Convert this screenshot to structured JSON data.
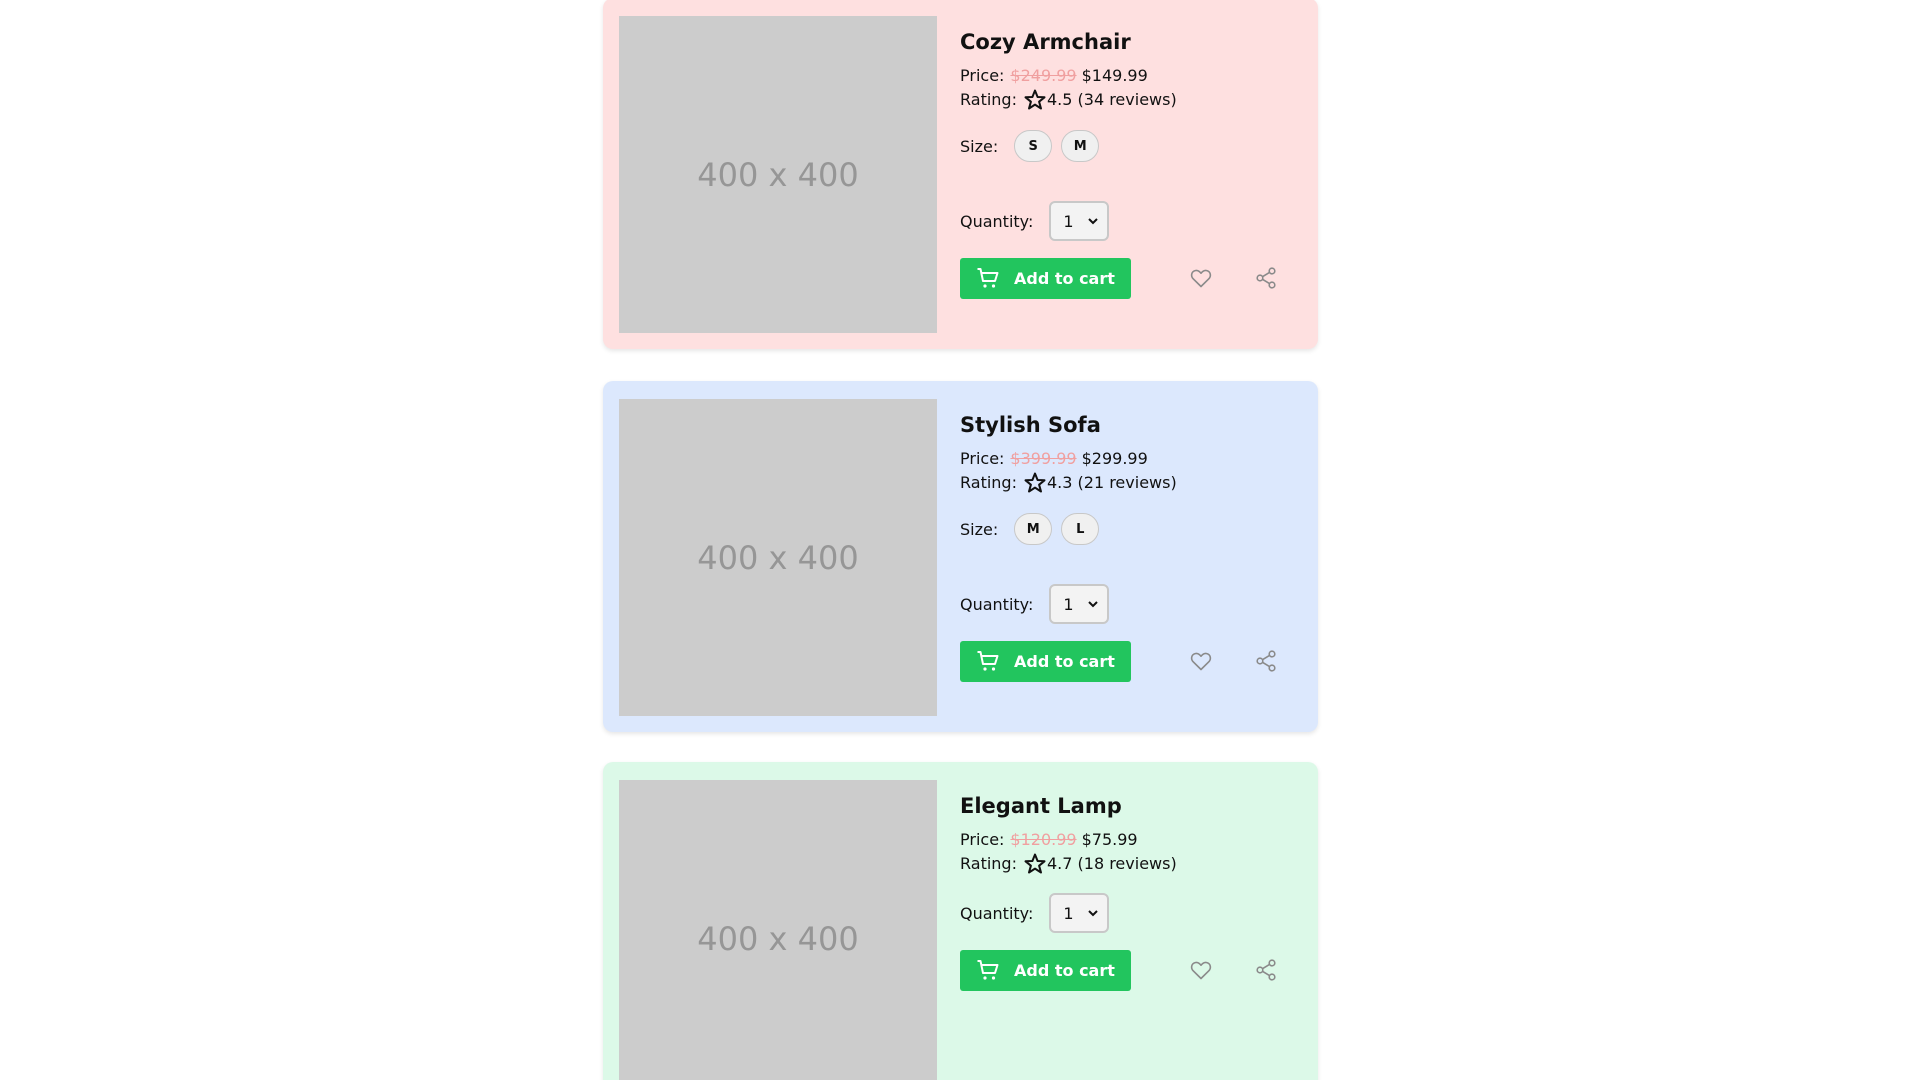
{
  "labels": {
    "price": "Price:",
    "rating": "Rating:",
    "size": "Size:",
    "quantity": "Quantity:",
    "add_to_cart": "Add to cart",
    "image_placeholder": "400 x 400"
  },
  "products": [
    {
      "title": "Cozy Armchair",
      "old_price": "$249.99",
      "price": "$149.99",
      "rating": "4.5 (34 reviews)",
      "sizes": [
        "S",
        "M"
      ],
      "quantity": "1",
      "background": "#fee0e0"
    },
    {
      "title": "Stylish Sofa",
      "old_price": "$399.99",
      "price": "$299.99",
      "rating": "4.3 (21 reviews)",
      "sizes": [
        "M",
        "L"
      ],
      "quantity": "1",
      "background": "#dce8fd"
    },
    {
      "title": "Elegant Lamp",
      "old_price": "$120.99",
      "price": "$75.99",
      "rating": "4.7 (18 reviews)",
      "sizes": [],
      "quantity": "1",
      "background": "#dcf9e8"
    }
  ],
  "colors": {
    "button": "#22c55e",
    "old_price": "#f0a0a0",
    "icon": "#8a8a8a"
  },
  "icons": {
    "star": "star-icon",
    "cart": "cart-icon",
    "heart": "heart-icon",
    "share": "share-icon",
    "chevron": "chevron-down-icon"
  }
}
